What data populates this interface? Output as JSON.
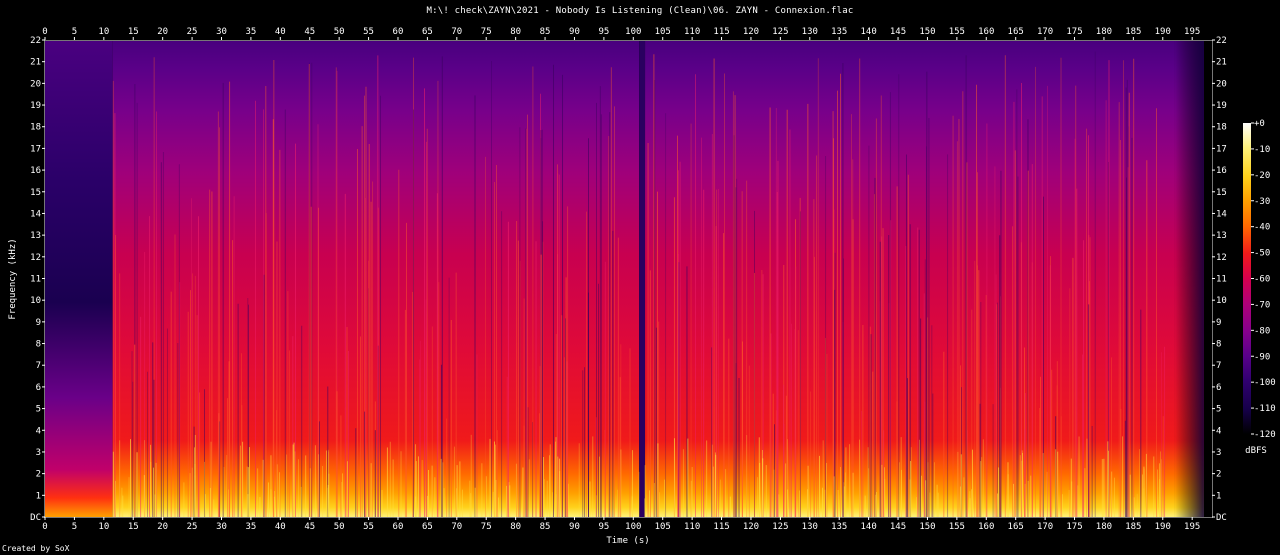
{
  "title": "M:\\! check\\ZAYN\\2021 - Nobody Is Listening (Clean)\\06. ZAYN - Connexion.flac",
  "credit": "Created by SoX",
  "chart_data": {
    "type": "heatmap",
    "xlabel": "Time (s)",
    "ylabel": "Frequency (kHz)",
    "xlim": [
      0,
      197
    ],
    "ylim": [
      0,
      22
    ],
    "x_ticks": [
      0,
      5,
      10,
      15,
      20,
      25,
      30,
      35,
      40,
      45,
      50,
      55,
      60,
      65,
      70,
      75,
      80,
      85,
      90,
      95,
      100,
      105,
      110,
      115,
      120,
      125,
      130,
      135,
      140,
      145,
      150,
      155,
      160,
      165,
      170,
      175,
      180,
      185,
      190,
      195
    ],
    "y_ticks": [
      "DC",
      "1",
      "2",
      "3",
      "4",
      "5",
      "6",
      "7",
      "8",
      "9",
      "10",
      "11",
      "12",
      "13",
      "14",
      "15",
      "16",
      "17",
      "18",
      "19",
      "20",
      "21",
      "22"
    ],
    "colorbar": {
      "label": "dBFS",
      "range": [
        -120,
        0
      ],
      "ticks": [
        "+0",
        "-10",
        "-20",
        "-30",
        "-40",
        "-50",
        "-60",
        "-70",
        "-80",
        "-90",
        "-100",
        "-110",
        "-120"
      ],
      "colors": [
        "#ffffff",
        "#fff27a",
        "#ffd21c",
        "#ffa000",
        "#ff6a00",
        "#f01a1a",
        "#d5004d",
        "#b00078",
        "#86008c",
        "#58008a",
        "#300070",
        "#16004a",
        "#000000"
      ]
    },
    "sections": [
      {
        "from": 0,
        "to": 11.5,
        "level": "quiet intro, energy below 9 kHz"
      },
      {
        "from": 11.5,
        "to": 101,
        "level": "loud, energy up to 21.5 kHz"
      },
      {
        "from": 101,
        "to": 102,
        "level": "brief drop"
      },
      {
        "from": 102,
        "to": 192,
        "level": "loud, energy up to 21.5 kHz"
      },
      {
        "from": 192,
        "to": 197,
        "level": "fade out"
      }
    ]
  }
}
